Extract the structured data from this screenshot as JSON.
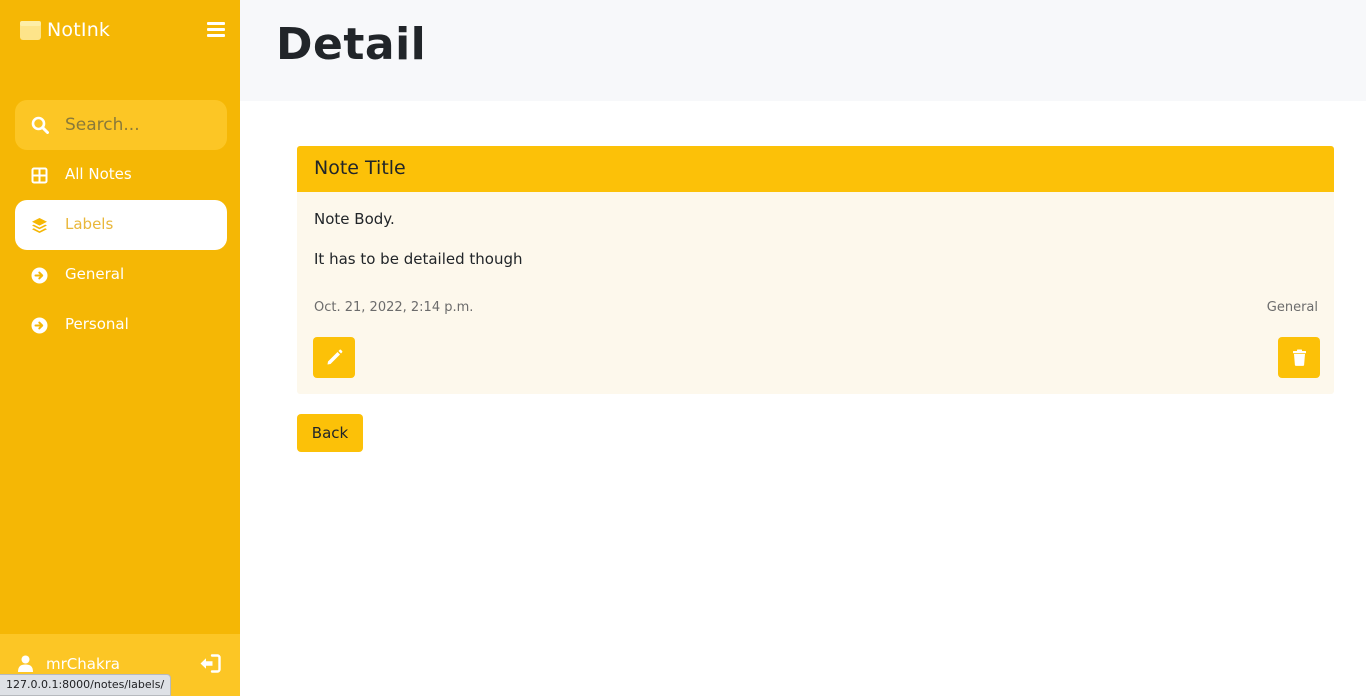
{
  "sidebar": {
    "brand": "NotInk",
    "search_placeholder": "Search...",
    "nav": [
      {
        "label": "All Notes",
        "icon": "grid-icon"
      },
      {
        "label": "Labels",
        "icon": "layers-icon",
        "active": true
      },
      {
        "label": "General",
        "icon": "arrow-circle-right-icon"
      },
      {
        "label": "Personal",
        "icon": "arrow-circle-right-icon"
      }
    ],
    "user": "mrChakra"
  },
  "status_url": "127.0.0.1:8000/notes/labels/",
  "header": {
    "title": "Detail"
  },
  "note": {
    "title": "Note Title",
    "body_lines": [
      "Note Body.",
      "It has to be detailed though"
    ],
    "date": "Oct. 21, 2022, 2:14 p.m.",
    "label": "General"
  },
  "actions": {
    "back": "Back"
  },
  "colors": {
    "sidebar": "#f5b705",
    "accent": "#fcc108",
    "card_bg": "#fdf8ec",
    "active_text": "#e9b73a"
  }
}
